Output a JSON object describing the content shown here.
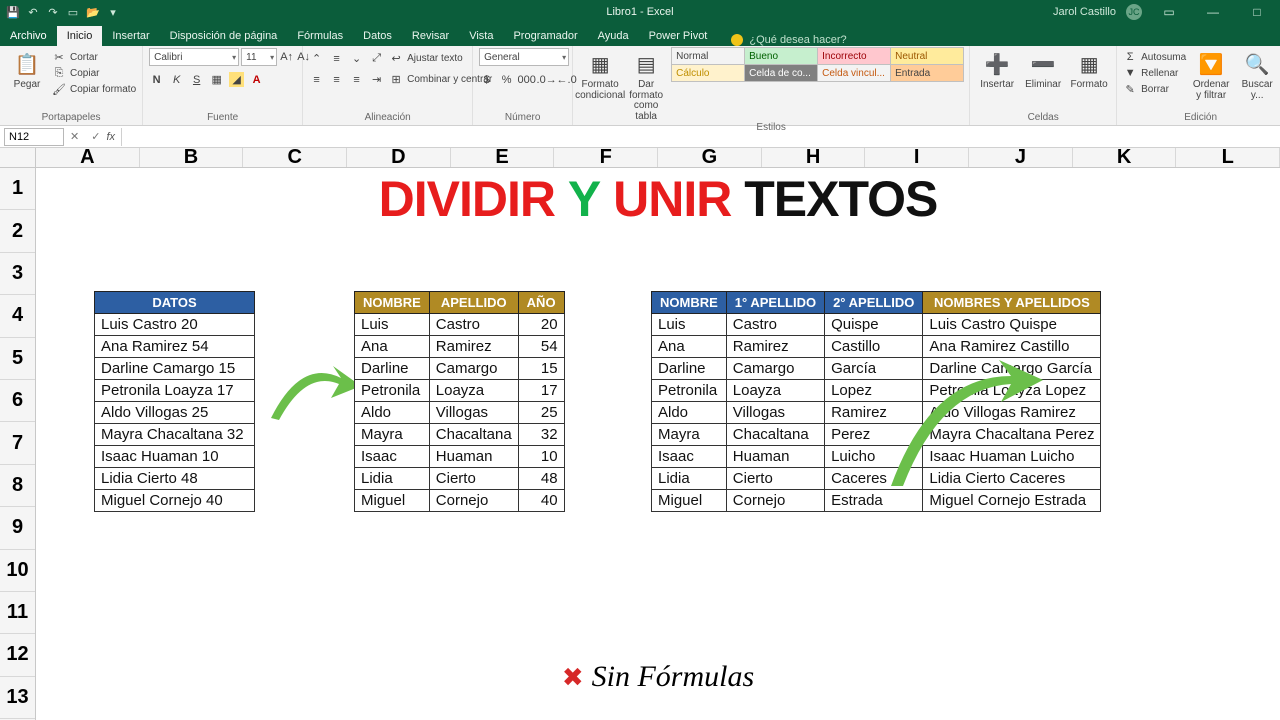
{
  "title": "Libro1 - Excel",
  "user": "Jarol Castillo",
  "user_initials": "JC",
  "tabs": [
    "Archivo",
    "Inicio",
    "Insertar",
    "Disposición de página",
    "Fórmulas",
    "Datos",
    "Revisar",
    "Vista",
    "Programador",
    "Ayuda",
    "Power Pivot"
  ],
  "active_tab": "Inicio",
  "tell_me": "¿Qué desea hacer?",
  "ribbon": {
    "clipboard": {
      "paste": "Pegar",
      "cut": "Cortar",
      "copy": "Copiar",
      "format_painter": "Copiar formato",
      "label": "Portapapeles"
    },
    "font": {
      "name": "Calibri",
      "size": "11",
      "label": "Fuente"
    },
    "align": {
      "wrap": "Ajustar texto",
      "merge": "Combinar y centrar",
      "label": "Alineación"
    },
    "number": {
      "format": "General",
      "label": "Número"
    },
    "styles": {
      "cond": "Formato condicional",
      "fmt": "Dar formato como tabla",
      "cells": [
        "Normal",
        "Bueno",
        "Incorrecto",
        "Neutral",
        "Cálculo",
        "Celda de co...",
        "Celda vincul...",
        "Entrada"
      ],
      "label": "Estilos"
    },
    "cells": {
      "insert": "Insertar",
      "delete": "Eliminar",
      "format": "Formato",
      "label": "Celdas"
    },
    "editing": {
      "autosum": "Autosuma",
      "fill": "Rellenar",
      "clear": "Borrar",
      "sort": "Ordenar y filtrar",
      "find": "Buscar y...",
      "label": "Edición"
    }
  },
  "namebox": "N12",
  "promo": {
    "a": "DIVIDIR",
    "b": "Y",
    "c": "UNIR",
    "d": "TEXTOS"
  },
  "table1": {
    "header": "DATOS",
    "rows": [
      "Luis Castro 20",
      "Ana Ramirez 54",
      "Darline Camargo 15",
      "Petronila Loayza 17",
      "Aldo Villogas 25",
      "Mayra Chacaltana 32",
      "Isaac Huaman 10",
      "Lidia Cierto 48",
      "Miguel Cornejo 40"
    ]
  },
  "table2": {
    "headers": [
      "NOMBRE",
      "APELLIDO",
      "AÑO"
    ],
    "rows": [
      [
        "Luis",
        "Castro",
        "20"
      ],
      [
        "Ana",
        "Ramirez",
        "54"
      ],
      [
        "Darline",
        "Camargo",
        "15"
      ],
      [
        "Petronila",
        "Loayza",
        "17"
      ],
      [
        "Aldo",
        "Villogas",
        "25"
      ],
      [
        "Mayra",
        "Chacaltana",
        "32"
      ],
      [
        "Isaac",
        "Huaman",
        "10"
      ],
      [
        "Lidia",
        "Cierto",
        "48"
      ],
      [
        "Miguel",
        "Cornejo",
        "40"
      ]
    ]
  },
  "table3": {
    "headers": [
      "NOMBRE",
      "1° APELLIDO",
      "2° APELLIDO",
      "NOMBRES Y APELLIDOS"
    ],
    "rows": [
      [
        "Luis",
        "Castro",
        "Quispe",
        "Luis Castro Quispe"
      ],
      [
        "Ana",
        "Ramirez",
        "Castillo",
        "Ana Ramirez Castillo"
      ],
      [
        "Darline",
        "Camargo",
        "García",
        "Darline Camargo García"
      ],
      [
        "Petronila",
        "Loayza",
        "Lopez",
        "Petronila Loayza Lopez"
      ],
      [
        "Aldo",
        "Villogas",
        "Ramirez",
        "Aldo Villogas Ramirez"
      ],
      [
        "Mayra",
        "Chacaltana",
        "Perez",
        "Mayra Chacaltana Perez"
      ],
      [
        "Isaac",
        "Huaman",
        "Luicho",
        "Isaac Huaman Luicho"
      ],
      [
        "Lidia",
        "Cierto",
        "Caceres",
        "Lidia Cierto Caceres"
      ],
      [
        "Miguel",
        "Cornejo",
        "Estrada",
        "Miguel Cornejo Estrada"
      ]
    ]
  },
  "footer": "Sin Fórmulas",
  "cols": [
    "A",
    "B",
    "C",
    "D",
    "E",
    "F",
    "G",
    "H",
    "I",
    "J",
    "K",
    "L"
  ],
  "rows": [
    "1",
    "2",
    "3",
    "4",
    "5",
    "6",
    "7",
    "8",
    "9",
    "10",
    "11",
    "12",
    "13"
  ]
}
